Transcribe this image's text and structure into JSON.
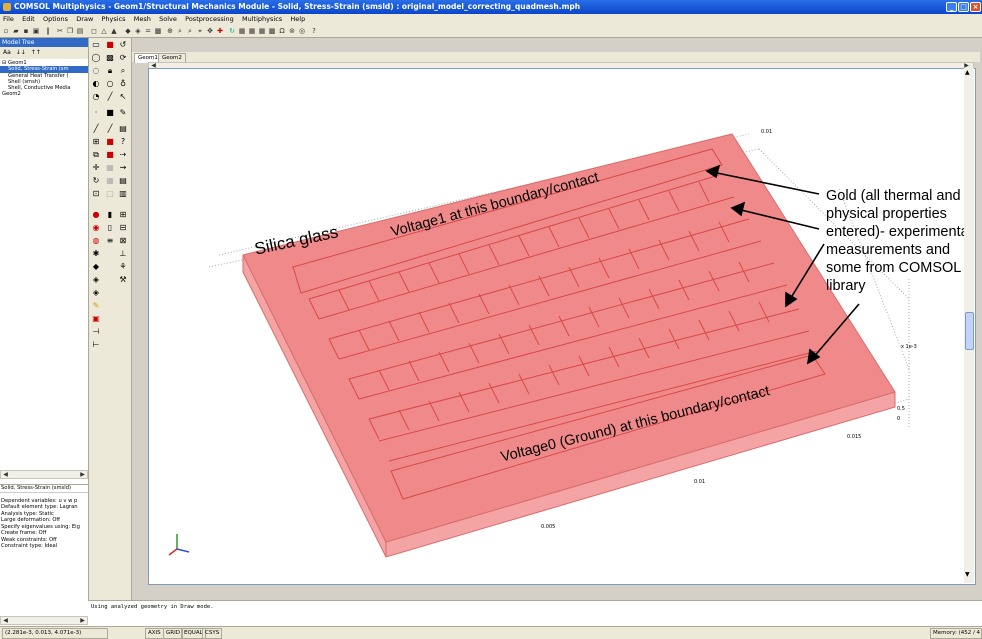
{
  "window": {
    "title": "COMSOL Multiphysics - Geom1/Structural Mechanics Module - Solid, Stress-Strain (smsld) : original_model_correcting_quadmesh.mph",
    "minimize": "_",
    "maximize": "□",
    "close": "×"
  },
  "menu": [
    "File",
    "Edit",
    "Options",
    "Draw",
    "Physics",
    "Mesh",
    "Solve",
    "Postprocessing",
    "Multiphysics",
    "Help"
  ],
  "model_tree": {
    "title": "Model Tree",
    "tabs": [
      "Aa",
      "↓↓",
      "↑↑"
    ],
    "items": [
      "⊟ Geom1",
      "Solid, Stress-Strain (sm",
      "General Heat Transfer (",
      "Shell (smsh)",
      "Shell, Conductive Media",
      "Geom2"
    ]
  },
  "properties": {
    "header": "Solid, Stress-Strain (smsld)",
    "lines": [
      "Dependent variables: u v w p",
      "Default element type: Lagran",
      "Analysis type: Static",
      "Large deformation: Off",
      "Specify eigenvalues using: Eig",
      "Create frame: Off",
      "Weak constraints: Off",
      "Constraint type: Ideal"
    ]
  },
  "geometry_tabs": [
    "Geom1",
    "Geom2"
  ],
  "axes": {
    "tick_a": "0.005",
    "tick_b": "0.01",
    "tick_c": "0.015",
    "tick_d": "0.01",
    "tick_e": "0.5",
    "tick_f": "0",
    "exponent": "x 1e-3"
  },
  "annotations": {
    "silica": "Silica glass",
    "voltage1": "Voltage1  at this boundary/contact",
    "voltage0": "Voltage0  (Ground) at this boundary/contact",
    "gold": "Gold (all thermal and\nphysical properties\nentered)- experimental\nmeasurements and\nsome from COMSOL\nlibrary"
  },
  "command_log": "Using analyzed geometry in Draw mode.",
  "status": {
    "coords": "(2.281e-3, 0.013, 4.071e-3)",
    "toggles": [
      "AXIS",
      "GRID",
      "EQUAL",
      "CSYS"
    ],
    "memory": "Memory: (452 / 4"
  },
  "colors": {
    "substrate_top": "#f08a8a",
    "substrate_side": "#f4a4a4",
    "gold_trace": "#d94848",
    "title_blue": "#0a46c8"
  }
}
